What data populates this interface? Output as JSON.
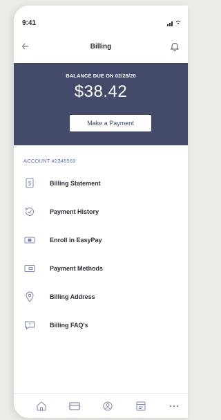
{
  "status": {
    "time": "9:41"
  },
  "header": {
    "title": "Billing",
    "back_icon": "back-arrow-icon",
    "notifications_icon": "bell-icon"
  },
  "balance": {
    "label": "BALANCE DUE ON 02/28/20",
    "amount": "$38.42",
    "button_label": "Make a Payment",
    "background_color": "#444a69"
  },
  "account": {
    "label": "ACCOUNT #2345563"
  },
  "menu": {
    "items": [
      {
        "label": "Billing Statement",
        "icon": "dollar-document-icon"
      },
      {
        "label": "Payment History",
        "icon": "history-clock-icon"
      },
      {
        "label": "Enroll in EasyPay",
        "icon": "cash-bill-icon"
      },
      {
        "label": "Payment Methods",
        "icon": "credit-card-icon"
      },
      {
        "label": "Billing Address",
        "icon": "location-pin-icon"
      },
      {
        "label": "Billing FAQ's",
        "icon": "question-chat-icon"
      }
    ]
  },
  "tabbar": {
    "tabs": [
      {
        "icon": "home-icon"
      },
      {
        "icon": "billing-card-icon"
      },
      {
        "icon": "account-circle-icon"
      },
      {
        "icon": "calendar-icon"
      },
      {
        "icon": "more-icon"
      }
    ]
  },
  "colors": {
    "accent": "#5d6fb4",
    "dark_text": "#2b2e3a",
    "icon_gray": "#7b84b8"
  }
}
